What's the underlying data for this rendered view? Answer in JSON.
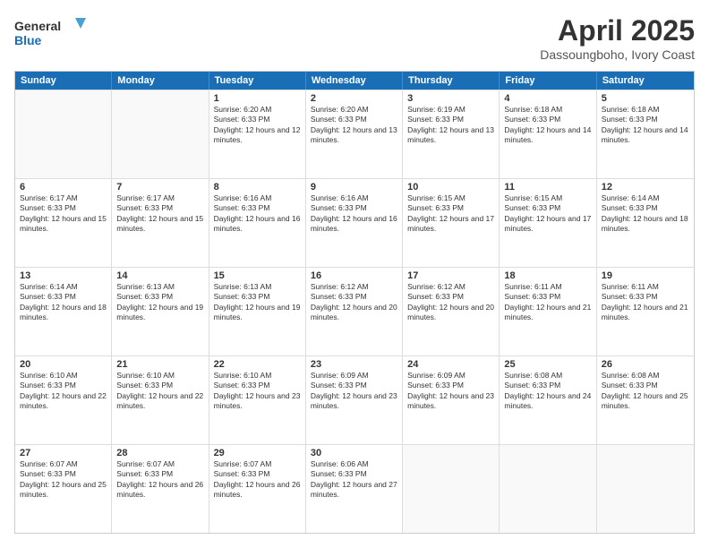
{
  "logo": {
    "line1": "General",
    "line2": "Blue"
  },
  "title": "April 2025",
  "subtitle": "Dassoungboho, Ivory Coast",
  "headers": [
    "Sunday",
    "Monday",
    "Tuesday",
    "Wednesday",
    "Thursday",
    "Friday",
    "Saturday"
  ],
  "weeks": [
    [
      {
        "day": "",
        "text": ""
      },
      {
        "day": "",
        "text": ""
      },
      {
        "day": "1",
        "text": "Sunrise: 6:20 AM\nSunset: 6:33 PM\nDaylight: 12 hours and 12 minutes."
      },
      {
        "day": "2",
        "text": "Sunrise: 6:20 AM\nSunset: 6:33 PM\nDaylight: 12 hours and 13 minutes."
      },
      {
        "day": "3",
        "text": "Sunrise: 6:19 AM\nSunset: 6:33 PM\nDaylight: 12 hours and 13 minutes."
      },
      {
        "day": "4",
        "text": "Sunrise: 6:18 AM\nSunset: 6:33 PM\nDaylight: 12 hours and 14 minutes."
      },
      {
        "day": "5",
        "text": "Sunrise: 6:18 AM\nSunset: 6:33 PM\nDaylight: 12 hours and 14 minutes."
      }
    ],
    [
      {
        "day": "6",
        "text": "Sunrise: 6:17 AM\nSunset: 6:33 PM\nDaylight: 12 hours and 15 minutes."
      },
      {
        "day": "7",
        "text": "Sunrise: 6:17 AM\nSunset: 6:33 PM\nDaylight: 12 hours and 15 minutes."
      },
      {
        "day": "8",
        "text": "Sunrise: 6:16 AM\nSunset: 6:33 PM\nDaylight: 12 hours and 16 minutes."
      },
      {
        "day": "9",
        "text": "Sunrise: 6:16 AM\nSunset: 6:33 PM\nDaylight: 12 hours and 16 minutes."
      },
      {
        "day": "10",
        "text": "Sunrise: 6:15 AM\nSunset: 6:33 PM\nDaylight: 12 hours and 17 minutes."
      },
      {
        "day": "11",
        "text": "Sunrise: 6:15 AM\nSunset: 6:33 PM\nDaylight: 12 hours and 17 minutes."
      },
      {
        "day": "12",
        "text": "Sunrise: 6:14 AM\nSunset: 6:33 PM\nDaylight: 12 hours and 18 minutes."
      }
    ],
    [
      {
        "day": "13",
        "text": "Sunrise: 6:14 AM\nSunset: 6:33 PM\nDaylight: 12 hours and 18 minutes."
      },
      {
        "day": "14",
        "text": "Sunrise: 6:13 AM\nSunset: 6:33 PM\nDaylight: 12 hours and 19 minutes."
      },
      {
        "day": "15",
        "text": "Sunrise: 6:13 AM\nSunset: 6:33 PM\nDaylight: 12 hours and 19 minutes."
      },
      {
        "day": "16",
        "text": "Sunrise: 6:12 AM\nSunset: 6:33 PM\nDaylight: 12 hours and 20 minutes."
      },
      {
        "day": "17",
        "text": "Sunrise: 6:12 AM\nSunset: 6:33 PM\nDaylight: 12 hours and 20 minutes."
      },
      {
        "day": "18",
        "text": "Sunrise: 6:11 AM\nSunset: 6:33 PM\nDaylight: 12 hours and 21 minutes."
      },
      {
        "day": "19",
        "text": "Sunrise: 6:11 AM\nSunset: 6:33 PM\nDaylight: 12 hours and 21 minutes."
      }
    ],
    [
      {
        "day": "20",
        "text": "Sunrise: 6:10 AM\nSunset: 6:33 PM\nDaylight: 12 hours and 22 minutes."
      },
      {
        "day": "21",
        "text": "Sunrise: 6:10 AM\nSunset: 6:33 PM\nDaylight: 12 hours and 22 minutes."
      },
      {
        "day": "22",
        "text": "Sunrise: 6:10 AM\nSunset: 6:33 PM\nDaylight: 12 hours and 23 minutes."
      },
      {
        "day": "23",
        "text": "Sunrise: 6:09 AM\nSunset: 6:33 PM\nDaylight: 12 hours and 23 minutes."
      },
      {
        "day": "24",
        "text": "Sunrise: 6:09 AM\nSunset: 6:33 PM\nDaylight: 12 hours and 23 minutes."
      },
      {
        "day": "25",
        "text": "Sunrise: 6:08 AM\nSunset: 6:33 PM\nDaylight: 12 hours and 24 minutes."
      },
      {
        "day": "26",
        "text": "Sunrise: 6:08 AM\nSunset: 6:33 PM\nDaylight: 12 hours and 25 minutes."
      }
    ],
    [
      {
        "day": "27",
        "text": "Sunrise: 6:07 AM\nSunset: 6:33 PM\nDaylight: 12 hours and 25 minutes."
      },
      {
        "day": "28",
        "text": "Sunrise: 6:07 AM\nSunset: 6:33 PM\nDaylight: 12 hours and 26 minutes."
      },
      {
        "day": "29",
        "text": "Sunrise: 6:07 AM\nSunset: 6:33 PM\nDaylight: 12 hours and 26 minutes."
      },
      {
        "day": "30",
        "text": "Sunrise: 6:06 AM\nSunset: 6:33 PM\nDaylight: 12 hours and 27 minutes."
      },
      {
        "day": "",
        "text": ""
      },
      {
        "day": "",
        "text": ""
      },
      {
        "day": "",
        "text": ""
      }
    ]
  ]
}
